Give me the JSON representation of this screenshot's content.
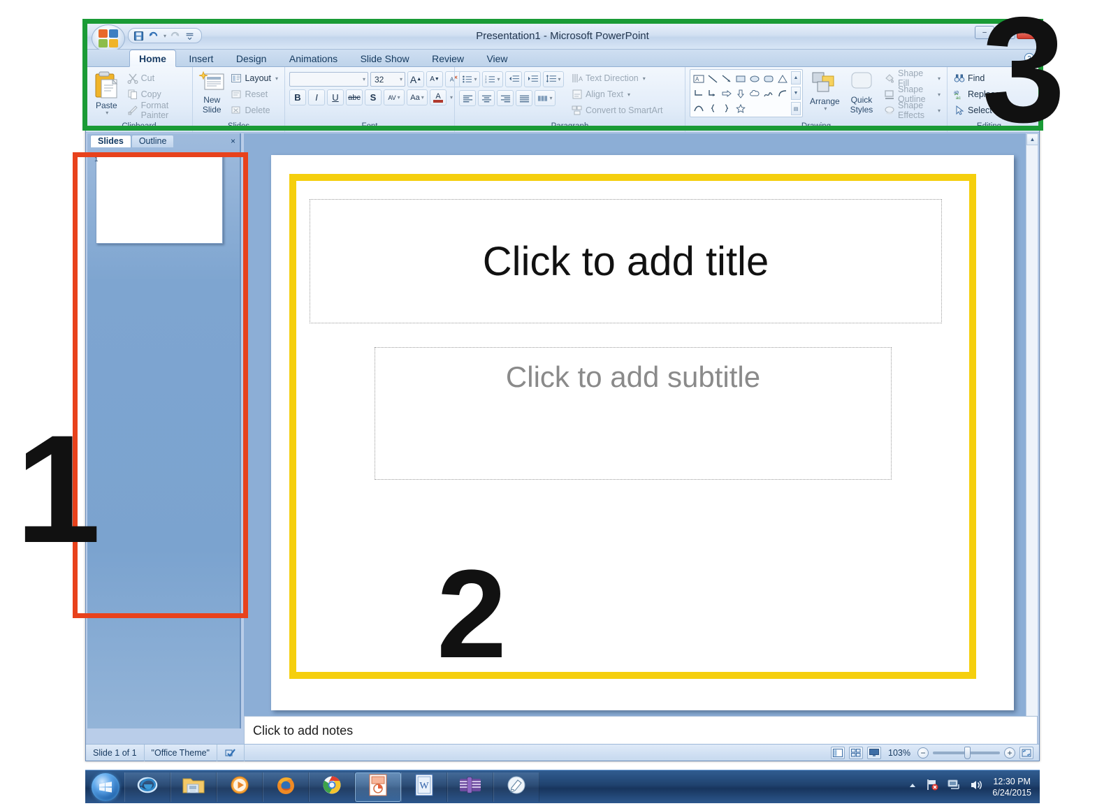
{
  "window": {
    "title": "Presentation1 - Microsoft PowerPoint",
    "minimize_label": "–",
    "maximize_label": "□",
    "close_label": "✕",
    "office_button": "office-orb",
    "quick_access": [
      {
        "name": "save-icon",
        "glyph": "💾"
      },
      {
        "name": "undo-icon",
        "glyph": "↶"
      },
      {
        "name": "redo-icon",
        "glyph": "↷"
      },
      {
        "name": "customize-qat-icon",
        "glyph": "☰"
      }
    ],
    "help_icon": "?"
  },
  "ribbon": {
    "tabs": [
      {
        "label": "Home",
        "active": true
      },
      {
        "label": "Insert",
        "active": false
      },
      {
        "label": "Design",
        "active": false
      },
      {
        "label": "Animations",
        "active": false
      },
      {
        "label": "Slide Show",
        "active": false
      },
      {
        "label": "Review",
        "active": false
      },
      {
        "label": "View",
        "active": false
      }
    ],
    "groups": [
      {
        "label": "Clipboard",
        "big_button": {
          "label_line1": "Paste",
          "icon": "clipboard-icon"
        },
        "items": [
          {
            "label": "Cut",
            "icon": "scissors-icon"
          },
          {
            "label": "Copy",
            "icon": "copy-icon"
          },
          {
            "label": "Format Painter",
            "icon": "paintbrush-icon"
          }
        ]
      },
      {
        "label": "Slides",
        "big_button": {
          "label_line1": "New",
          "label_line2": "Slide",
          "icon": "new-slide-icon"
        },
        "items": [
          {
            "label": "Layout",
            "icon": "layout-icon"
          },
          {
            "label": "Reset",
            "icon": "reset-icon"
          },
          {
            "label": "Delete",
            "icon": "delete-slide-icon"
          }
        ]
      },
      {
        "label": "Font",
        "font_name": "",
        "font_name_placeholder": "",
        "font_size": "32",
        "buttons_row1": [
          "grow-font-icon",
          "shrink-font-icon",
          "clear-formatting-icon"
        ],
        "buttons_row2": [
          {
            "label": "B",
            "name": "bold-button"
          },
          {
            "label": "I",
            "name": "italic-button"
          },
          {
            "label": "U",
            "name": "underline-button"
          },
          {
            "label": "abc",
            "name": "strikethrough-button"
          },
          {
            "label": "S",
            "name": "text-shadow-button"
          },
          {
            "label": "AV",
            "name": "character-spacing-button"
          },
          {
            "label": "Aa",
            "name": "change-case-button"
          },
          {
            "label": "A",
            "name": "font-color-button"
          }
        ]
      },
      {
        "label": "Paragraph",
        "items": [
          {
            "label": "Text Direction",
            "icon": "text-direction-icon"
          },
          {
            "label": "Align Text",
            "icon": "align-text-icon"
          },
          {
            "label": "Convert to SmartArt",
            "icon": "smartart-icon"
          }
        ]
      },
      {
        "label": "Drawing",
        "arrange_label": "Arrange",
        "quick_styles_line1": "Quick",
        "quick_styles_line2": "Styles",
        "items": [
          {
            "label": "Shape Fill",
            "icon": "shape-fill-icon"
          },
          {
            "label": "Shape Outline",
            "icon": "shape-outline-icon"
          },
          {
            "label": "Shape Effects",
            "icon": "shape-effects-icon"
          }
        ]
      },
      {
        "label": "Editing",
        "items": [
          {
            "label": "Find",
            "icon": "binoculars-icon"
          },
          {
            "label": "Replace",
            "icon": "replace-icon"
          },
          {
            "label": "Select",
            "icon": "select-cursor-icon"
          }
        ]
      }
    ]
  },
  "slide_panel": {
    "tabs": [
      {
        "label": "Slides",
        "active": true
      },
      {
        "label": "Outline",
        "active": false
      }
    ],
    "close_label": "×",
    "thumbnail_number": "1"
  },
  "slide": {
    "title_placeholder": "Click to add title",
    "subtitle_placeholder": "Click to add subtitle"
  },
  "notes": {
    "placeholder": "Click to add notes"
  },
  "status_bar": {
    "slide_count": "Slide 1 of 1",
    "theme": "\"Office Theme\"",
    "spellcheck_icon": "spellcheck-icon",
    "views": [
      {
        "name": "normal-view-button",
        "selected": true
      },
      {
        "name": "slide-sorter-view-button",
        "selected": false
      },
      {
        "name": "slide-show-view-button",
        "selected": false
      }
    ],
    "zoom_level": "103%",
    "zoom_out_label": "−",
    "zoom_in_label": "+",
    "fit_to_window_icon": "fit-to-window-icon"
  },
  "taskbar": {
    "start_label": "start-orb",
    "items": [
      {
        "name": "internet-explorer-icon",
        "active": false
      },
      {
        "name": "windows-explorer-icon",
        "active": false
      },
      {
        "name": "windows-media-player-icon",
        "active": false
      },
      {
        "name": "firefox-icon",
        "active": false
      },
      {
        "name": "google-chrome-icon",
        "active": false
      },
      {
        "name": "powerpoint-icon",
        "active": true
      },
      {
        "name": "word-icon",
        "active": false
      },
      {
        "name": "winrar-icon",
        "active": false
      },
      {
        "name": "paint-icon",
        "active": false
      }
    ],
    "tray": [
      {
        "name": "show-hidden-icons-icon",
        "glyph": "▲"
      },
      {
        "name": "network-error-icon",
        "glyph": "⚑"
      },
      {
        "name": "network-icon",
        "glyph": "🖥"
      },
      {
        "name": "volume-icon",
        "glyph": "🔊"
      }
    ],
    "clock_time": "12:30 PM",
    "clock_date": "6/24/2015"
  },
  "annotations": {
    "marker_1": "1",
    "marker_2": "2",
    "marker_3": "3",
    "color_1": "#e8421c",
    "color_2": "#f5cf0d",
    "color_3": "#1a9b36"
  }
}
